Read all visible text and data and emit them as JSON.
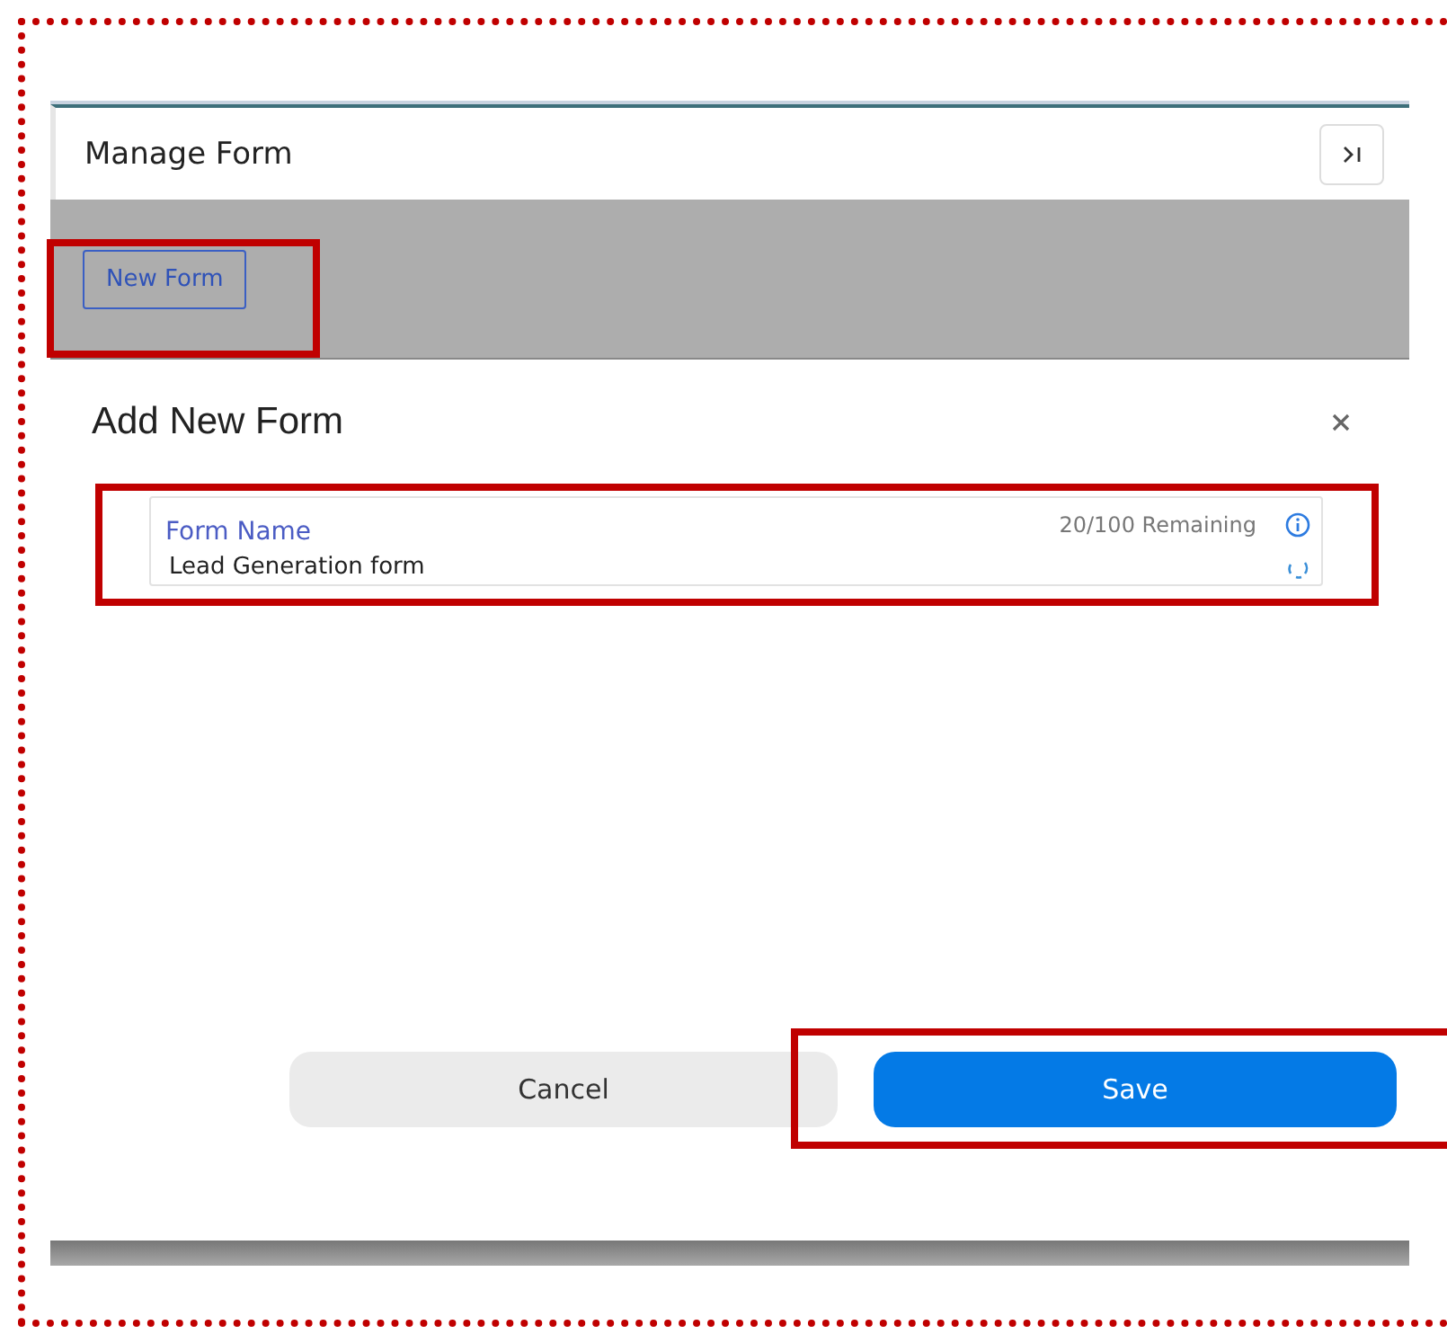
{
  "panel": {
    "title": "Manage Form",
    "new_button": "New Form"
  },
  "dialog": {
    "title": "Add New Form",
    "field": {
      "label": "Form Name",
      "counter": "20/100 Remaining",
      "value": "Lead Generation form"
    },
    "buttons": [
      {
        "label": "Cancel",
        "kind": "secondary"
      },
      {
        "label": "Save",
        "kind": "primary"
      }
    ]
  }
}
